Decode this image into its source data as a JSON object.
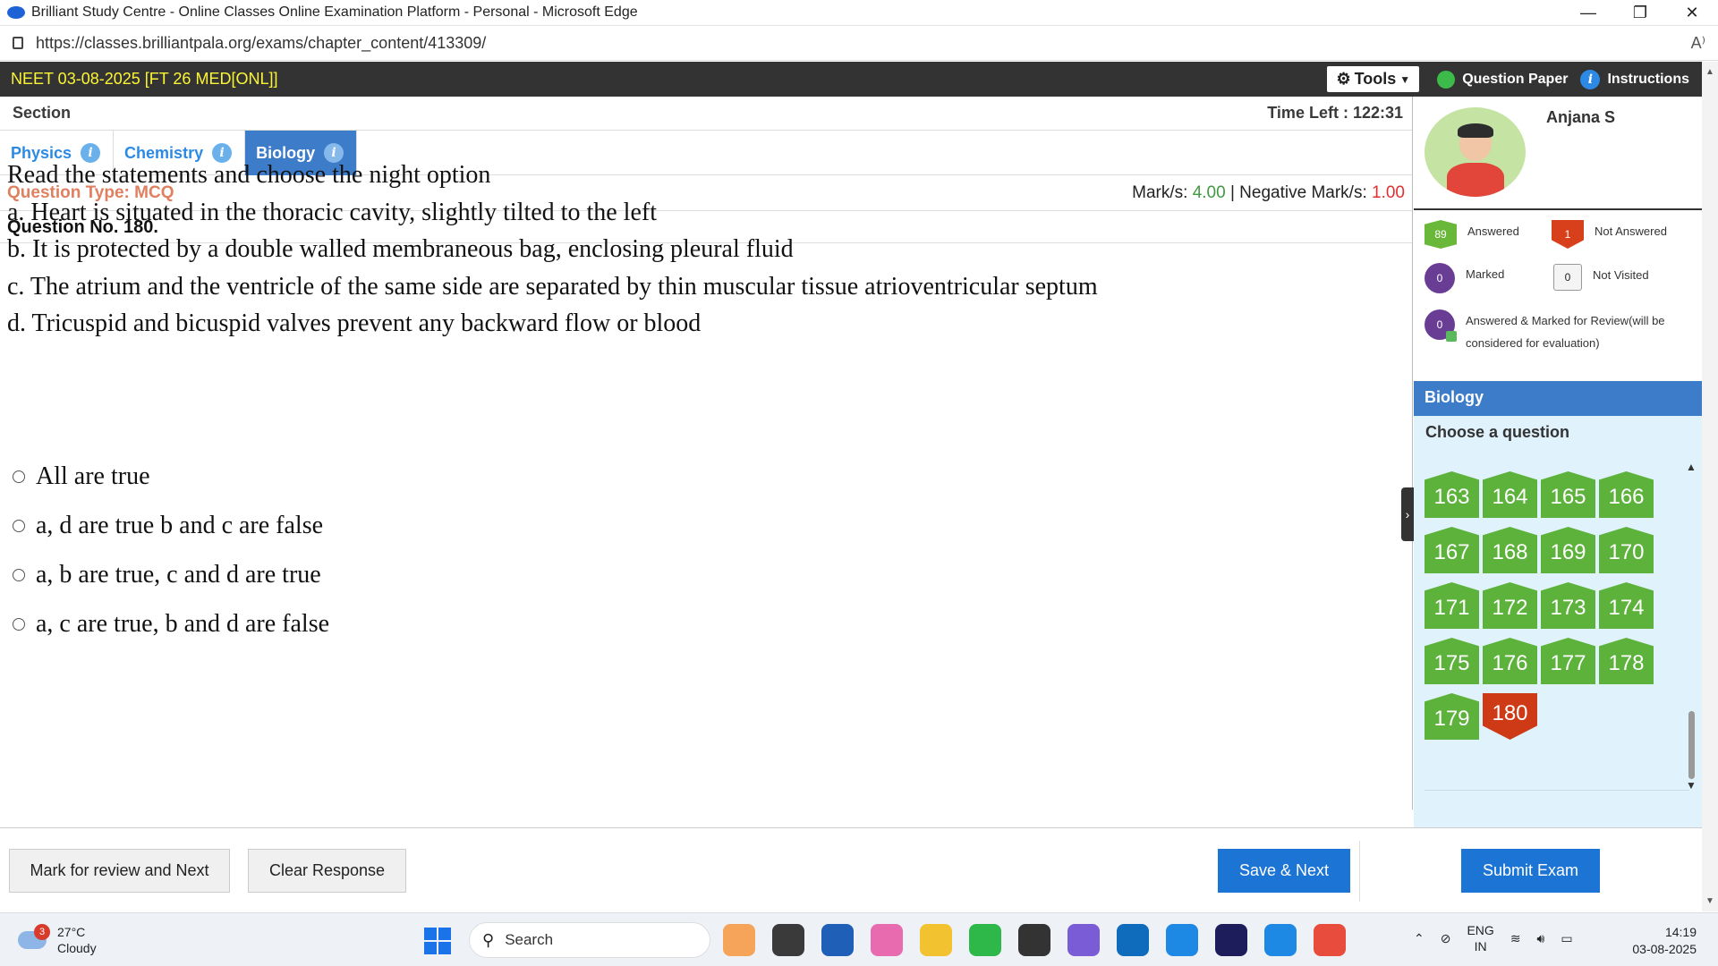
{
  "browser": {
    "window_title": "Brilliant Study Centre - Online Classes Online Examination Platform - Personal - Microsoft Edge",
    "url": "https://classes.brilliantpala.org/exams/chapter_content/413309/",
    "minimize": "—",
    "maximize": "❐",
    "close": "✕",
    "read_aloud": "A⁾"
  },
  "header": {
    "exam_name": "NEET 03-08-2025 [FT 26 MED[ONL]]",
    "tools_label": "Tools",
    "question_paper_label": "Question Paper",
    "instructions_label": "Instructions"
  },
  "section": {
    "label": "Section",
    "time_left": "Time Left : 122:31",
    "tabs": [
      {
        "label": "Physics",
        "active": false
      },
      {
        "label": "Chemistry",
        "active": false
      },
      {
        "label": "Biology",
        "active": true
      }
    ]
  },
  "question": {
    "type_label": "Question Type: MCQ",
    "marks_label": "Mark/s: ",
    "marks_value": "4.00",
    "separator": " | Negative Mark/s: ",
    "negative_value": "1.00",
    "number_label": "Question No. 180.",
    "lines": [
      "Read the statements and choose the night option",
      "a. Heart is situated in the thoracic cavity, slightly tilted to the left",
      "b. It is protected by a double walled membraneous bag, enclosing pleural fluid",
      "c. The atrium and the ventricle of the same side are separated by thin muscular tissue atrioventricular septum",
      "d. Tricuspid and bicuspid valves prevent any backward flow or blood"
    ],
    "options": [
      "All are true",
      "a, d are true b and c are false",
      "a, b are true, c and d are true",
      "a, c are true, b and d are false"
    ]
  },
  "buttons": {
    "mark_review": "Mark for review and Next",
    "clear": "Clear Response",
    "save_next": "Save & Next",
    "submit": "Submit Exam"
  },
  "profile": {
    "name": "Anjana S"
  },
  "legend": {
    "answered_count": "89",
    "answered_label": "Answered",
    "not_answered_count": "1",
    "not_answered_label": "Not Answered",
    "marked_count": "0",
    "marked_label": "Marked",
    "not_visited_count": "0",
    "not_visited_label": "Not Visited",
    "answered_marked_count": "0",
    "answered_marked_label_1": "Answered & Marked for Review(will be",
    "answered_marked_label_2": "considered for evaluation)"
  },
  "palette": {
    "subject": "Biology",
    "choose_label": "Choose a question",
    "questions": [
      {
        "no": "163",
        "status": "answered"
      },
      {
        "no": "164",
        "status": "answered"
      },
      {
        "no": "165",
        "status": "answered"
      },
      {
        "no": "166",
        "status": "answered"
      },
      {
        "no": "167",
        "status": "answered"
      },
      {
        "no": "168",
        "status": "answered"
      },
      {
        "no": "169",
        "status": "answered"
      },
      {
        "no": "170",
        "status": "answered"
      },
      {
        "no": "171",
        "status": "answered"
      },
      {
        "no": "172",
        "status": "answered"
      },
      {
        "no": "173",
        "status": "answered"
      },
      {
        "no": "174",
        "status": "answered"
      },
      {
        "no": "175",
        "status": "answered"
      },
      {
        "no": "176",
        "status": "answered"
      },
      {
        "no": "177",
        "status": "answered"
      },
      {
        "no": "178",
        "status": "answered"
      },
      {
        "no": "179",
        "status": "answered"
      },
      {
        "no": "180",
        "status": "not_answered"
      }
    ]
  },
  "taskbar": {
    "weather_badge": "3",
    "temperature": "27°C",
    "condition": "Cloudy",
    "search_placeholder": "Search",
    "lang_1": "ENG",
    "lang_2": "IN",
    "time": "14:19",
    "date": "03-08-2025",
    "app_colors": [
      "#f6a45a",
      "#3a3a3a",
      "#1f5fb8",
      "#e86bb0",
      "#f2c230",
      "#2fb84a",
      "#333333",
      "#7a5cd6",
      "#0f6cbd",
      "#1e88e5",
      "#1d1d5c",
      "#1e88e5",
      "#e74c3c"
    ]
  },
  "colors": {
    "answered": "#5cb23a",
    "not_answered": "#cf3a16",
    "accent": "#1c74d4"
  }
}
